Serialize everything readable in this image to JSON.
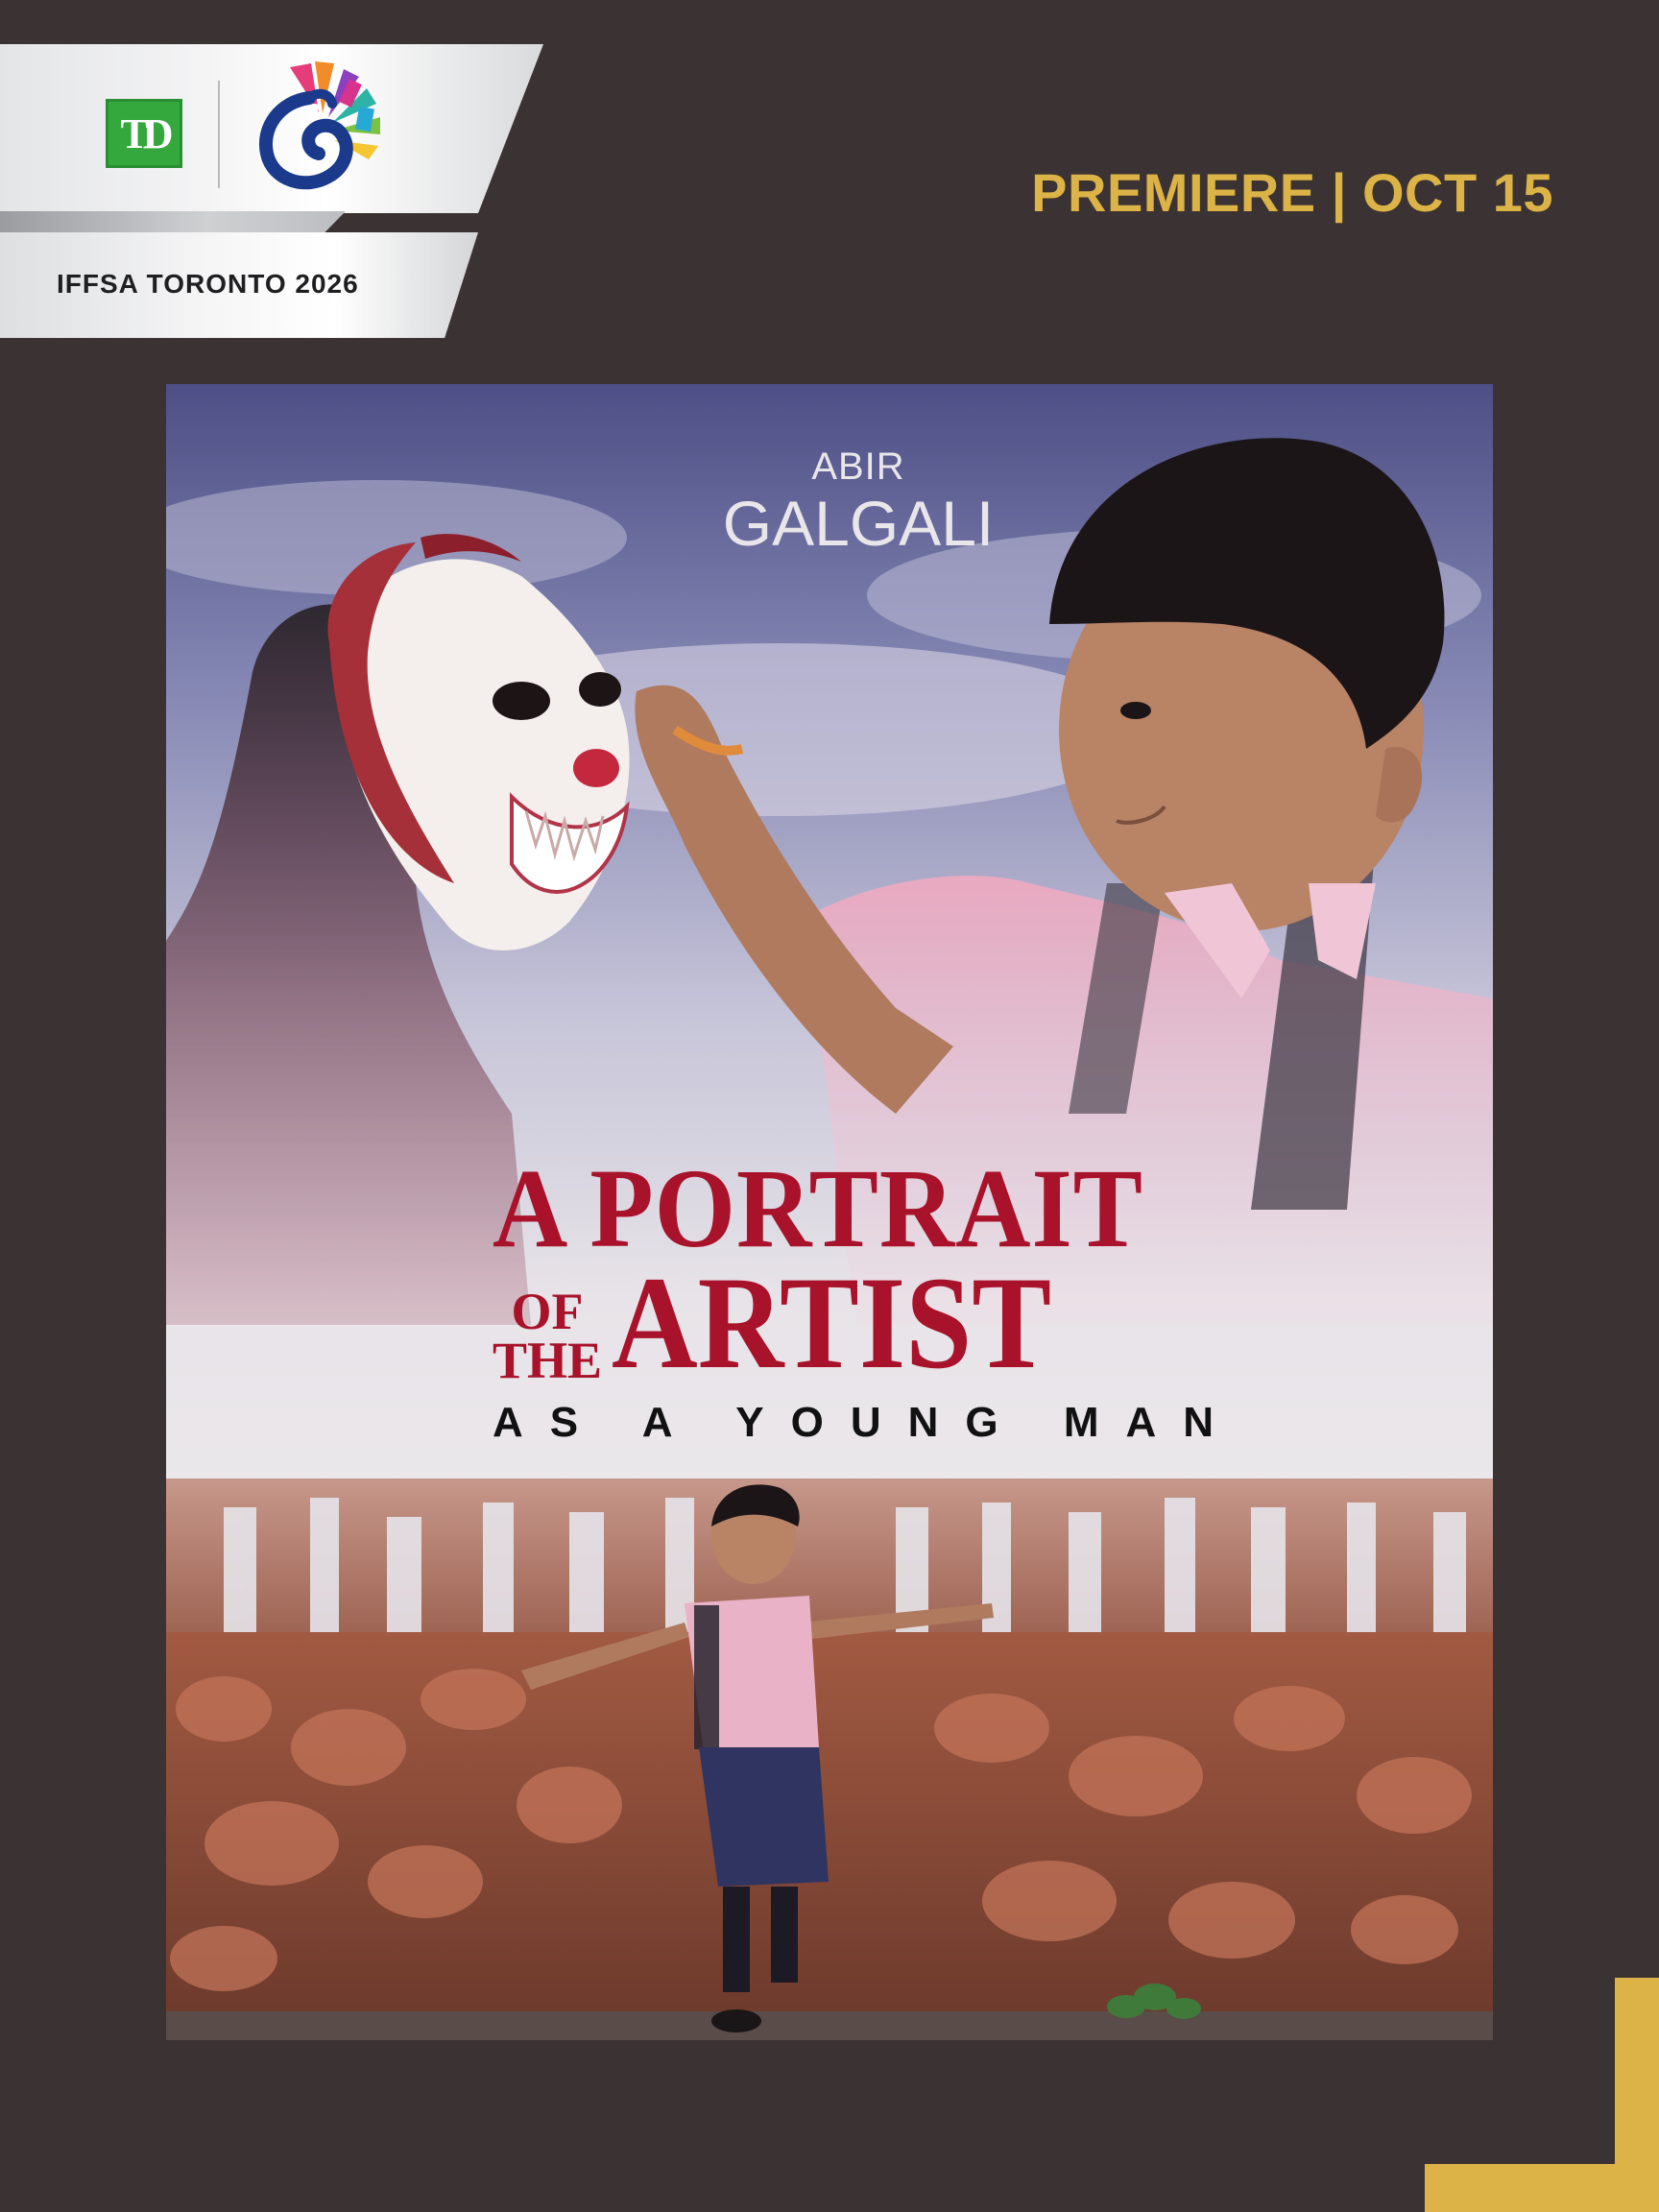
{
  "banner": {
    "label": "IFFSA TORONTO 2026",
    "sponsor_logo_text": "TD",
    "sponsor_logo_color": "#34a83d",
    "festival_logo_icon": "peacock-film-logo"
  },
  "premiere": {
    "text": "PREMIERE | OCT 15",
    "color": "#dcb346"
  },
  "poster": {
    "actor_first": "ABIR",
    "actor_last": "GALGALI",
    "title_line1": "A PORTRAIT",
    "title_of": "OF",
    "title_the": "THE",
    "title_artist": "ARTIST",
    "title_sub": "AS A YOUNG MAN",
    "title_color": "#a8122a"
  },
  "colors": {
    "background": "#3b3233",
    "accent": "#dcb346"
  }
}
